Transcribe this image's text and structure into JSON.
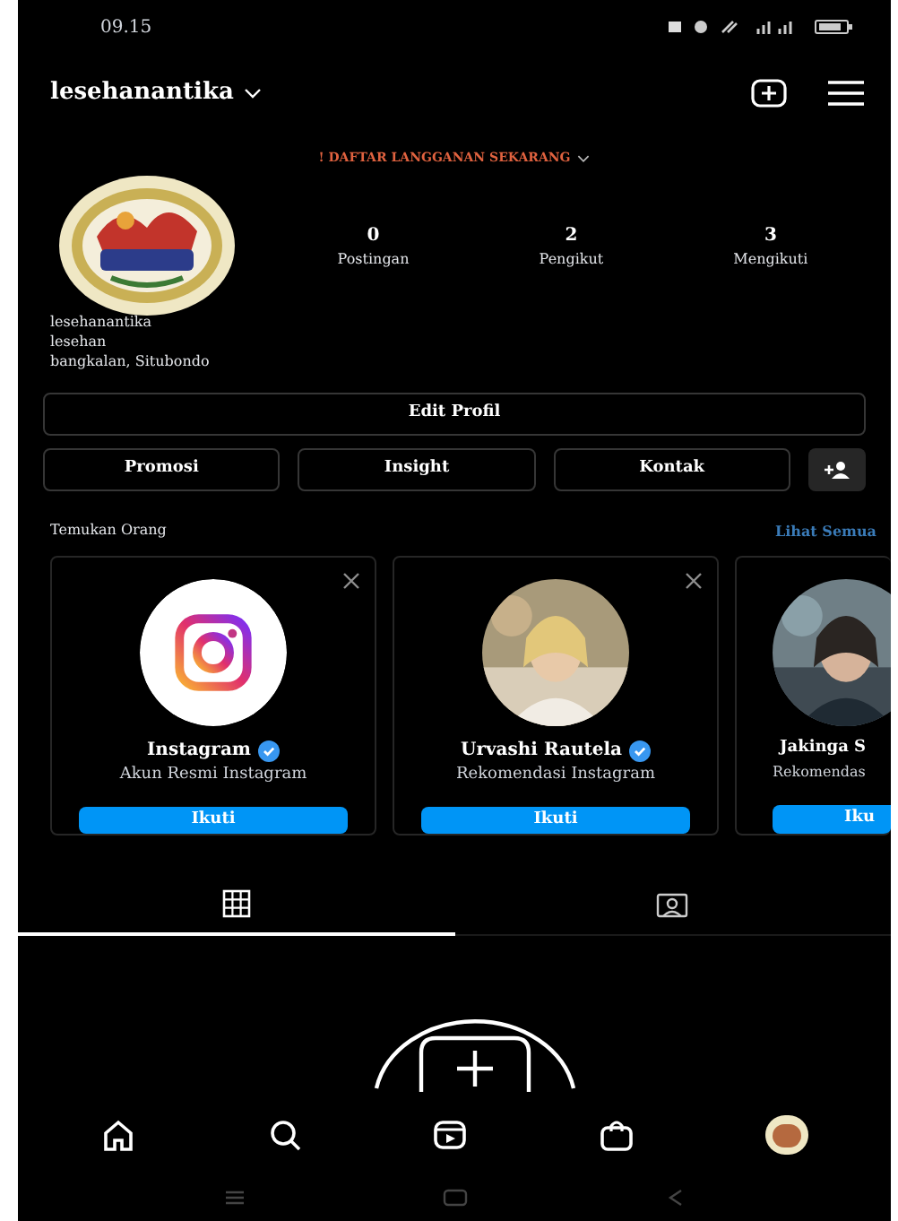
{
  "status_bar": {
    "time": "09.15"
  },
  "header": {
    "username": "lesehanantika"
  },
  "banner": {
    "text": "! DAFTAR LANGGANAN SEKARANG"
  },
  "stats": [
    {
      "value": "0",
      "label": "Postingan"
    },
    {
      "value": "2",
      "label": "Pengikut"
    },
    {
      "value": "3",
      "label": "Mengikuti"
    }
  ],
  "bio": [
    "lesehanantika",
    "lesehan",
    "bangkalan, Situbondo"
  ],
  "edit_button": "Edit Profil",
  "action_buttons": [
    "Promosi",
    "Insight",
    "Kontak"
  ],
  "suggestions": {
    "title": "Temukan Orang",
    "see_all": "Lihat Semua",
    "cards": [
      {
        "kind": "logo",
        "name": "Instagram",
        "verified": true,
        "subtitle": "Akun Resmi Instagram",
        "button": "Ikuti",
        "dismissable": true
      },
      {
        "kind": "picture",
        "name": "Urvashi Rautela",
        "verified": true,
        "subtitle": "Rekomendasi Instagram",
        "button": "Ikuti",
        "dismissable": true
      },
      {
        "kind": "picture",
        "name": "Jakinga S",
        "verified": false,
        "subtitle": "Rekomendas",
        "button": "Iku",
        "dismissable": false
      }
    ]
  },
  "tabs": [
    {
      "kind": "grid",
      "selected": true
    },
    {
      "kind": "tagged",
      "selected": false
    }
  ]
}
